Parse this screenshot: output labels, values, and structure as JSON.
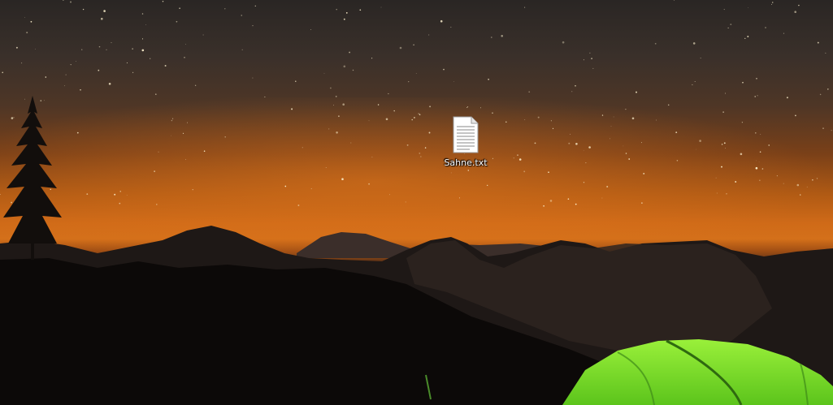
{
  "desktop": {
    "icons": [
      {
        "label": "Sahne.txt",
        "icon": "text-file-icon"
      }
    ]
  },
  "wallpaper": {
    "description_colors": {
      "sky_top": "#2a2624",
      "horizon_glow": "#d4701a",
      "tent": "#7fe62a"
    }
  }
}
